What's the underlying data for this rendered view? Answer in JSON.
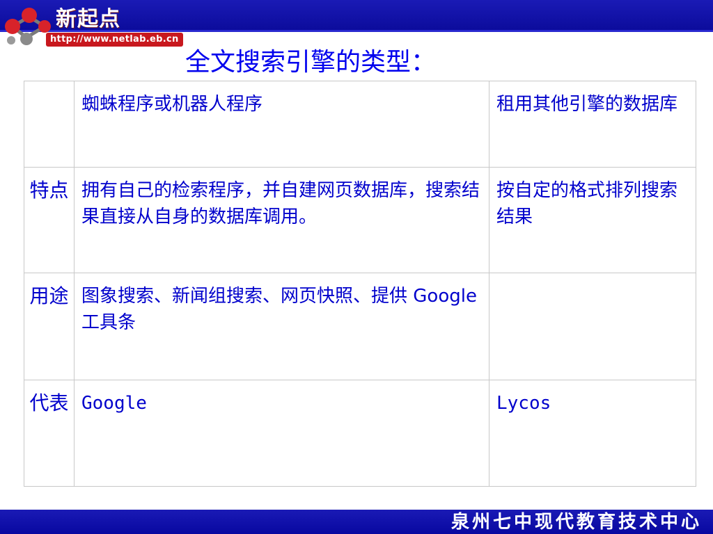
{
  "header": {
    "logo_text": "新起点",
    "logo_url": "http://www.netlab.eb.cn",
    "colors": {
      "banner": "#0b0b9a",
      "accent": "#c8181e",
      "text": "#0000ee"
    }
  },
  "title": "全文搜索引擎的类型：",
  "table": {
    "header_row": [
      "",
      "蜘蛛程序或机器人程序",
      "租用其他引擎的数据库"
    ],
    "rows": [
      {
        "label": "特点",
        "col1": "拥有自己的检索程序，并自建网页数据库，搜索结果直接从自身的数据库调用。",
        "col2": "按自定的格式排列搜索结果"
      },
      {
        "label": "用途",
        "col1": "图象搜索、新闻组搜索、网页快照、提供 Google工具条",
        "col2": ""
      },
      {
        "label": "代表",
        "col1": "Google",
        "col2": "Lycos"
      }
    ]
  },
  "footer": {
    "text": "泉州七中现代教育技术中心"
  }
}
